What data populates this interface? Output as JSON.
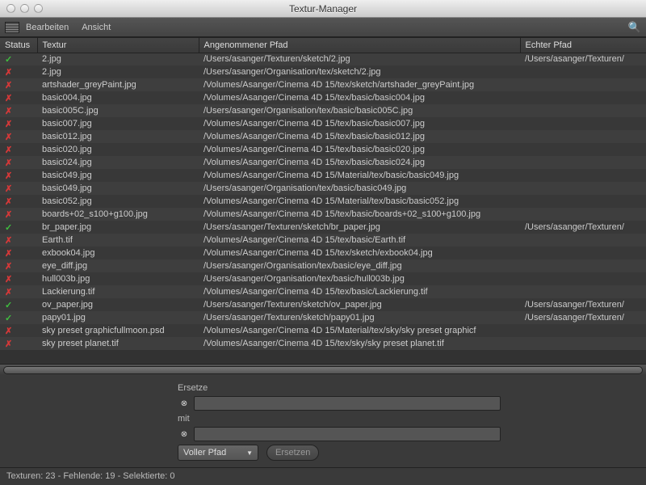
{
  "window": {
    "title": "Textur-Manager"
  },
  "menubar": {
    "edit": "Bearbeiten",
    "view": "Ansicht"
  },
  "columns": {
    "status": "Status",
    "texture": "Textur",
    "assumed": "Angenommener Pfad",
    "real": "Echter Pfad"
  },
  "rows": [
    {
      "status": "ok",
      "tex": "2.jpg",
      "path": "/Users/asanger/Texturen/sketch/2.jpg",
      "real": "/Users/asanger/Texturen/"
    },
    {
      "status": "err",
      "tex": "2.jpg",
      "path": "/Users/asanger/Organisation/tex/sketch/2.jpg",
      "real": ""
    },
    {
      "status": "err",
      "tex": "artshader_greyPaint.jpg",
      "path": "/Volumes/Asanger/Cinema 4D 15/tex/sketch/artshader_greyPaint.jpg",
      "real": ""
    },
    {
      "status": "err",
      "tex": "basic004.jpg",
      "path": "/Volumes/Asanger/Cinema 4D 15/tex/basic/basic004.jpg",
      "real": ""
    },
    {
      "status": "err",
      "tex": "basic005C.jpg",
      "path": "/Users/asanger/Organisation/tex/basic/basic005C.jpg",
      "real": ""
    },
    {
      "status": "err",
      "tex": "basic007.jpg",
      "path": "/Volumes/Asanger/Cinema 4D 15/tex/basic/basic007.jpg",
      "real": ""
    },
    {
      "status": "err",
      "tex": "basic012.jpg",
      "path": "/Volumes/Asanger/Cinema 4D 15/tex/basic/basic012.jpg",
      "real": ""
    },
    {
      "status": "err",
      "tex": "basic020.jpg",
      "path": "/Volumes/Asanger/Cinema 4D 15/tex/basic/basic020.jpg",
      "real": ""
    },
    {
      "status": "err",
      "tex": "basic024.jpg",
      "path": "/Volumes/Asanger/Cinema 4D 15/tex/basic/basic024.jpg",
      "real": ""
    },
    {
      "status": "err",
      "tex": "basic049.jpg",
      "path": "/Volumes/Asanger/Cinema 4D 15/Material/tex/basic/basic049.jpg",
      "real": ""
    },
    {
      "status": "err",
      "tex": "basic049.jpg",
      "path": "/Users/asanger/Organisation/tex/basic/basic049.jpg",
      "real": ""
    },
    {
      "status": "err",
      "tex": "basic052.jpg",
      "path": "/Volumes/Asanger/Cinema 4D 15/Material/tex/basic/basic052.jpg",
      "real": ""
    },
    {
      "status": "err",
      "tex": "boards+02_s100+g100.jpg",
      "path": "/Volumes/Asanger/Cinema 4D 15/tex/basic/boards+02_s100+g100.jpg",
      "real": ""
    },
    {
      "status": "ok",
      "tex": "br_paper.jpg",
      "path": "/Users/asanger/Texturen/sketch/br_paper.jpg",
      "real": "/Users/asanger/Texturen/"
    },
    {
      "status": "err",
      "tex": "Earth.tif",
      "path": "/Volumes/Asanger/Cinema 4D 15/tex/basic/Earth.tif",
      "real": ""
    },
    {
      "status": "err",
      "tex": "exbook04.jpg",
      "path": "/Volumes/Asanger/Cinema 4D 15/tex/sketch/exbook04.jpg",
      "real": ""
    },
    {
      "status": "err",
      "tex": "eye_diff.jpg",
      "path": "/Users/asanger/Organisation/tex/basic/eye_diff.jpg",
      "real": ""
    },
    {
      "status": "err",
      "tex": "hull003b.jpg",
      "path": "/Users/asanger/Organisation/tex/basic/hull003b.jpg",
      "real": ""
    },
    {
      "status": "err",
      "tex": "Lackierung.tif",
      "path": "/Volumes/Asanger/Cinema 4D 15/tex/basic/Lackierung.tif",
      "real": ""
    },
    {
      "status": "ok",
      "tex": "ov_paper.jpg",
      "path": "/Users/asanger/Texturen/sketch/ov_paper.jpg",
      "real": "/Users/asanger/Texturen/"
    },
    {
      "status": "ok",
      "tex": "papy01.jpg",
      "path": "/Users/asanger/Texturen/sketch/papy01.jpg",
      "real": "/Users/asanger/Texturen/"
    },
    {
      "status": "err",
      "tex": "sky preset graphicfullmoon.psd",
      "path": "/Volumes/Asanger/Cinema 4D 15/Material/tex/sky/sky preset graphicf",
      "real": ""
    },
    {
      "status": "err",
      "tex": "sky preset planet.tif",
      "path": "/Volumes/Asanger/Cinema 4D 15/tex/sky/sky preset planet.tif",
      "real": ""
    }
  ],
  "replace": {
    "ersetze_label": "Ersetze",
    "mit_label": "mit",
    "ersetze_value": "",
    "mit_value": "",
    "dropdown_label": "Voller Pfad",
    "button_label": "Ersetzen"
  },
  "status": {
    "text": "Texturen: 23 - Fehlende: 19 - Selektierte: 0"
  }
}
